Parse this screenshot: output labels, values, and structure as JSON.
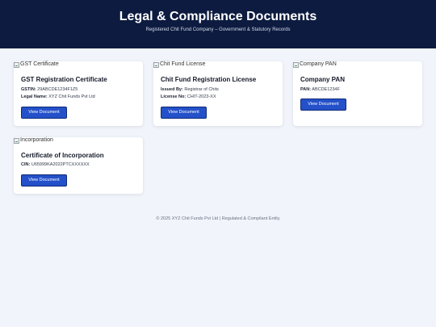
{
  "header": {
    "title": "Legal & Compliance Documents",
    "subtitle": "Registered Chit Fund Company – Government & Statutory Records"
  },
  "documents": [
    {
      "image_alt": "GST Certificate",
      "title": "GST Registration Certificate",
      "fields": [
        {
          "label": "GSTIN:",
          "value": "29ABCDE1234F1Z5"
        },
        {
          "label": "Legal Name:",
          "value": "XYZ Chit Funds Pvt Ltd"
        }
      ],
      "button_label": "View Document"
    },
    {
      "image_alt": "Chit Fund License",
      "title": "Chit Fund Registration License",
      "fields": [
        {
          "label": "Issued By:",
          "value": "Registrar of Chits"
        },
        {
          "label": "License No:",
          "value": "CHIT-2023-XX"
        }
      ],
      "button_label": "View Document"
    },
    {
      "image_alt": "Company PAN",
      "title": "Company PAN",
      "fields": [
        {
          "label": "PAN:",
          "value": "ABCDE1234F"
        }
      ],
      "button_label": "View Document"
    },
    {
      "image_alt": "Incorporation",
      "title": "Certificate of Incorporation",
      "fields": [
        {
          "label": "CIN:",
          "value": "U65999KA2022PTCXXXXXX"
        }
      ],
      "button_label": "View Document"
    }
  ],
  "footer": {
    "text": "© 2025 XYZ Chit Funds Pvt Ltd | Regulated & Compliant Entity"
  },
  "colors": {
    "header_bg": "#0c1b3f",
    "page_bg": "#f1f4fa",
    "button_bg": "#2451c9"
  }
}
